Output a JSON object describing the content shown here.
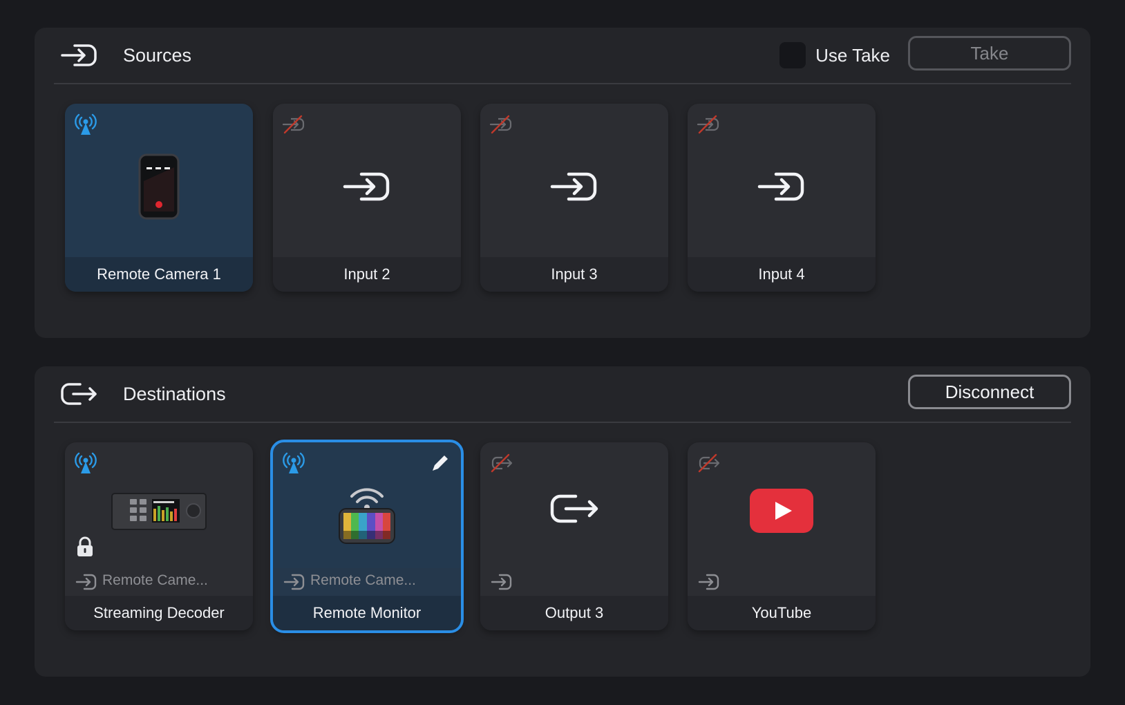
{
  "sources": {
    "title": "Sources",
    "header_icon": "input-icon",
    "use_take_label": "Use Take",
    "use_take_checked": false,
    "take_button": "Take",
    "tiles": [
      {
        "name": "Remote Camera 1",
        "status_icon": "broadcast-icon",
        "icon": "phone-camera-icon",
        "selected": true
      },
      {
        "name": "Input 2",
        "status_icon": "disconnected-icon",
        "icon": "input-icon",
        "selected": false
      },
      {
        "name": "Input 3",
        "status_icon": "disconnected-icon",
        "icon": "input-icon",
        "selected": false
      },
      {
        "name": "Input 4",
        "status_icon": "disconnected-icon",
        "icon": "input-icon",
        "selected": false
      }
    ]
  },
  "destinations": {
    "title": "Destinations",
    "header_icon": "output-icon",
    "disconnect_button": "Disconnect",
    "tiles": [
      {
        "name": "Streaming Decoder",
        "status_icon": "broadcast-icon",
        "icon": "decoder-device-icon",
        "source": "Remote Came...",
        "locked": true,
        "selected": false
      },
      {
        "name": "Remote Monitor",
        "status_icon": "broadcast-icon",
        "icon": "remote-monitor-icon",
        "source": "Remote Came...",
        "editable": true,
        "selected": true
      },
      {
        "name": "Output 3",
        "status_icon": "disconnected-icon",
        "icon": "output-icon",
        "source": "",
        "selected": false
      },
      {
        "name": "YouTube",
        "status_icon": "disconnected-icon",
        "icon": "youtube-icon",
        "source": "",
        "selected": false
      }
    ]
  },
  "colors": {
    "background": "#191a1e",
    "panel": "#242529",
    "tile": "#2c2d32",
    "selected_tile": "#23394f",
    "accent": "#2a8ee6",
    "broadcast": "#2b9be8",
    "youtube": "#e4303c"
  }
}
